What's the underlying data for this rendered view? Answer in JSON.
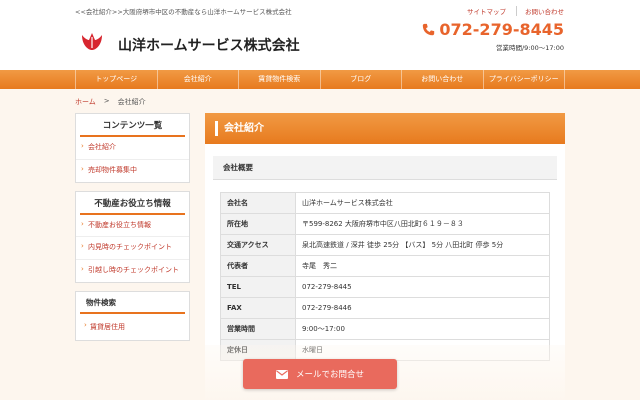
{
  "header": {
    "breadcrumb_text": "<<会社紹介>>大阪府堺市中区の不動産なら山洋ホームサービス株式会社",
    "company_name": "山洋ホームサービス株式会社",
    "top_links": [
      "サイトマップ",
      "お問い合わせ"
    ],
    "phone": "072-279-8445",
    "hours": "営業時間/9:00～17:00"
  },
  "nav": [
    "トップページ",
    "会社紹介",
    "賃貸物件検索",
    "ブログ",
    "お問い合わせ",
    "プライバシーポリシー"
  ],
  "breadcrumb": {
    "home": "ホーム",
    "sep": ">",
    "current": "会社紹介"
  },
  "sidebar": {
    "contents": {
      "title": "コンテンツ一覧",
      "items": [
        "会社紹介",
        "売却物件募集中"
      ]
    },
    "tips": {
      "title": "不動産お役立ち情報",
      "items": [
        "不動産お役立ち情報",
        "内見時のチェックポイント",
        "引越し時のチェックポイント"
      ]
    },
    "search": {
      "title": "物件検索",
      "items": [
        "賃貸居住用"
      ]
    }
  },
  "main": {
    "title": "会社紹介",
    "section_title": "会社概要",
    "rows": [
      {
        "k": "会社名",
        "v": "山洋ホームサービス株式会社"
      },
      {
        "k": "所在地",
        "v": "〒599-8262 大阪府堺市中区八田北町６１９－８３"
      },
      {
        "k": "交通アクセス",
        "v": "泉北高速鉄道 / 深井 徒歩 25分 【バス】 5分 八田北町 停歩 5分"
      },
      {
        "k": "代表者",
        "v": "寺尾　秀二"
      },
      {
        "k": "TEL",
        "v": "072-279-8445"
      },
      {
        "k": "FAX",
        "v": "072-279-8446"
      },
      {
        "k": "営業時間",
        "v": "9:00～17:00"
      },
      {
        "k": "定休日",
        "v": "水曜日"
      }
    ]
  },
  "mail_button": "メールでお問合せ",
  "colors": {
    "accent": "#e8731e",
    "link": "#c0392b",
    "phone": "#e8642c",
    "mail_button": "#e96a5d"
  }
}
